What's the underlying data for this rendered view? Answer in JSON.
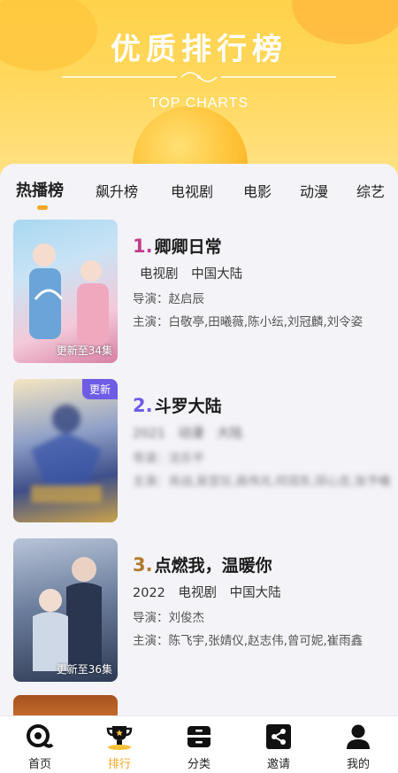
{
  "hero": {
    "title": "优质排行榜",
    "subtitle": "TOP CHARTS"
  },
  "tabs": [
    {
      "label": "热播榜"
    },
    {
      "label": "飙升榜"
    },
    {
      "label": "电视剧"
    },
    {
      "label": "电影"
    },
    {
      "label": "动漫"
    },
    {
      "label": "综艺"
    }
  ],
  "items": [
    {
      "rank": "1.",
      "rank_color": "#c43d8d",
      "title": "卿卿日常",
      "meta": [
        "电视剧",
        "中国大陆"
      ],
      "director": "导演：赵启辰",
      "cast": "主演：白敬亭,田曦薇,陈小纭,刘冠麟,刘令姿",
      "poster_label": "更新至34集"
    },
    {
      "rank": "2.",
      "rank_color": "#6f5ce6",
      "title": "斗罗大陆",
      "meta": [
        "2021",
        "动漫",
        "大陆"
      ],
      "director": "导演：沈乐平",
      "cast": "主演：肖战,吴宣仪,高伟光,何润东,邱心志,张予曦",
      "poster_badge": "更新"
    },
    {
      "rank": "3.",
      "rank_color": "#b07a2a",
      "title": "点燃我，温暖你",
      "meta": [
        "2022",
        "电视剧",
        "中国大陆"
      ],
      "director": "导演：刘俊杰",
      "cast": "主演：陈飞宇,张婧仪,赵志伟,曾可妮,崔雨鑫",
      "poster_label": "更新至36集"
    }
  ],
  "nav": [
    {
      "label": "首页",
      "icon": "home-icon"
    },
    {
      "label": "排行",
      "icon": "trophy-icon",
      "active": true
    },
    {
      "label": "分类",
      "icon": "category-icon"
    },
    {
      "label": "邀请",
      "icon": "share-icon"
    },
    {
      "label": "我的",
      "icon": "user-icon"
    }
  ],
  "colors": {
    "accent": "#f5a623",
    "hero": "#ffd24a",
    "badge": "#6f5ce6"
  }
}
